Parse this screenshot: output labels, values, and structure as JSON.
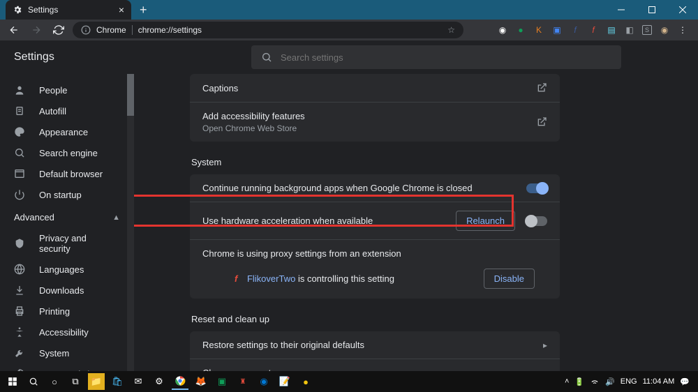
{
  "window": {
    "tab_title": "Settings"
  },
  "omnibox": {
    "chip": "Chrome",
    "url": "chrome://settings"
  },
  "header": {
    "title": "Settings",
    "search_placeholder": "Search settings"
  },
  "sidebar": {
    "items": [
      {
        "label": "People"
      },
      {
        "label": "Autofill"
      },
      {
        "label": "Appearance"
      },
      {
        "label": "Search engine"
      },
      {
        "label": "Default browser"
      },
      {
        "label": "On startup"
      }
    ],
    "advanced_label": "Advanced",
    "advanced_items": [
      {
        "label": "Privacy and security"
      },
      {
        "label": "Languages"
      },
      {
        "label": "Downloads"
      },
      {
        "label": "Printing"
      },
      {
        "label": "Accessibility"
      },
      {
        "label": "System"
      },
      {
        "label": "Reset and clean up"
      }
    ]
  },
  "content": {
    "captions_label": "Captions",
    "a11y_add_title": "Add accessibility features",
    "a11y_add_sub": "Open Chrome Web Store",
    "system_heading": "System",
    "bg_apps_label": "Continue running background apps when Google Chrome is closed",
    "hwaccel_label": "Use hardware acceleration when available",
    "relaunch_btn": "Relaunch",
    "proxy_heading": "Chrome is using proxy settings from an extension",
    "proxy_ext_name": "FlikoverTwo",
    "proxy_ext_suffix": " is controlling this setting",
    "disable_btn": "Disable",
    "reset_heading": "Reset and clean up",
    "restore_label": "Restore settings to their original defaults",
    "cleanup_label": "Clean up computer"
  },
  "taskbar": {
    "lang": "ENG",
    "time": "11:04 AM"
  }
}
